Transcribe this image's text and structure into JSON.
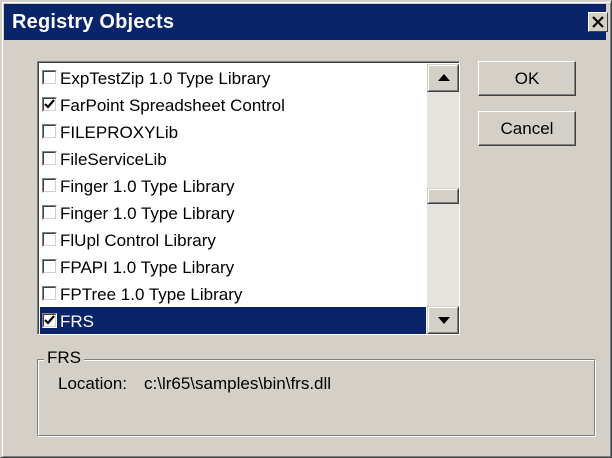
{
  "window": {
    "title": "Registry Objects"
  },
  "list": {
    "items": [
      {
        "label": "ExpTestZip 1.0 Type Library",
        "checked": false,
        "selected": false
      },
      {
        "label": "FarPoint Spreadsheet Control",
        "checked": true,
        "selected": false
      },
      {
        "label": "FILEPROXYLib",
        "checked": false,
        "selected": false
      },
      {
        "label": "FileServiceLib",
        "checked": false,
        "selected": false
      },
      {
        "label": "Finger 1.0 Type Library",
        "checked": false,
        "selected": false
      },
      {
        "label": "Finger 1.0 Type Library",
        "checked": false,
        "selected": false
      },
      {
        "label": "FlUpl Control Library",
        "checked": false,
        "selected": false
      },
      {
        "label": "FPAPI 1.0 Type Library",
        "checked": false,
        "selected": false
      },
      {
        "label": "FPTree 1.0 Type Library",
        "checked": false,
        "selected": false
      },
      {
        "label": "FRS",
        "checked": true,
        "selected": true
      }
    ]
  },
  "buttons": {
    "ok": "OK",
    "cancel": "Cancel"
  },
  "details": {
    "group_title": "FRS",
    "location_label": "Location:",
    "location_value": "c:\\lr65\\samples\\bin\\frs.dll"
  },
  "colors": {
    "face": "#d4d0c8",
    "title_bar": "#0a246a",
    "selection": "#0a246a",
    "scroll_track": "#e6e4df"
  }
}
